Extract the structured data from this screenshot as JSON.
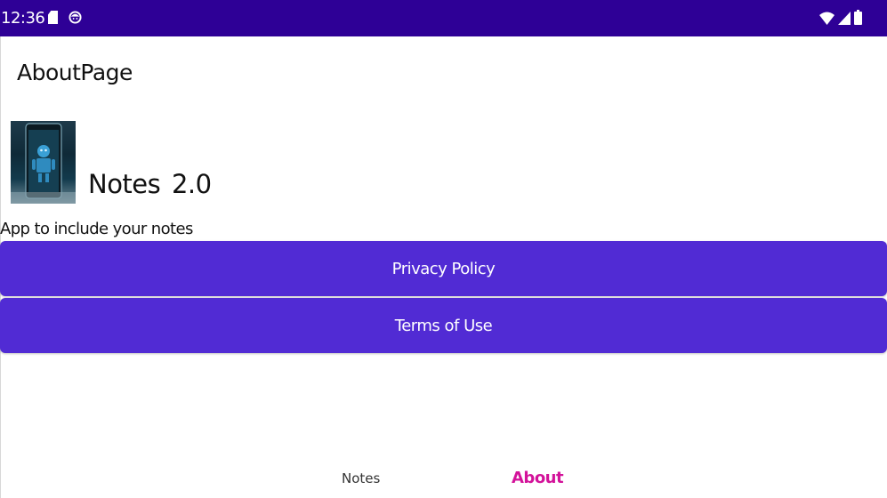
{
  "status_bar": {
    "time": "12:36",
    "background": "#2e0096",
    "left_icons": [
      "sd-card-icon",
      "face-icon"
    ],
    "right_icons": [
      "wifi-icon",
      "signal-icon",
      "battery-icon"
    ]
  },
  "page": {
    "title": "AboutPage"
  },
  "app": {
    "name": "Notes",
    "version": "2.0",
    "description": "App to include your notes",
    "image": "robot-phone-image"
  },
  "buttons": {
    "privacy_label": "Privacy Policy",
    "terms_label": "Terms of Use",
    "color": "#512bd4"
  },
  "tabs": {
    "notes_label": "Notes",
    "about_label": "About",
    "active": "About",
    "active_color": "#d3139a"
  }
}
